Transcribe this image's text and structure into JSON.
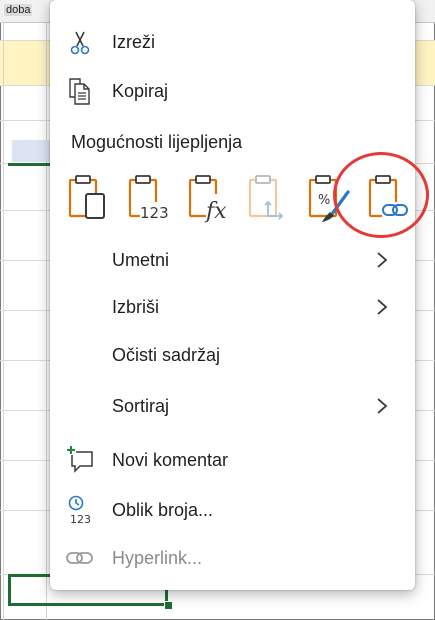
{
  "sheet": {
    "cell_text": "doba"
  },
  "menu": {
    "cut_label": "Izreži",
    "copy_label": "Kopiraj",
    "paste_options_title": "Mogućnosti lijepljenja",
    "insert_label": "Umetni",
    "delete_label": "Izbriši",
    "clear_label": "Očisti sadržaj",
    "sort_label": "Sortiraj",
    "new_comment_label": "Novi komentar",
    "number_format_label": "Oblik broja...",
    "hyperlink_label": "Hyperlink..."
  },
  "paste_options": [
    {
      "icon": "paste-icon"
    },
    {
      "icon": "paste-values-icon"
    },
    {
      "icon": "paste-formulas-icon"
    },
    {
      "icon": "paste-transpose-icon",
      "disabled": true
    },
    {
      "icon": "paste-formatting-icon"
    },
    {
      "icon": "paste-link-icon",
      "highlighted": true
    }
  ],
  "colors": {
    "accent_orange": "#d9730d",
    "selection_green": "#1e6e34",
    "highlight_red": "#e53935"
  }
}
